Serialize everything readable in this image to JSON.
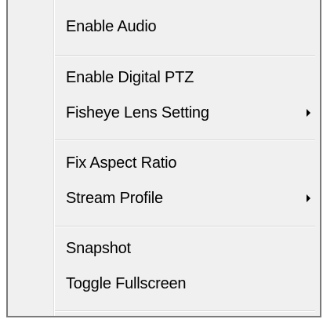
{
  "menu": {
    "items": [
      {
        "label": "Enable Audio"
      },
      {
        "label": "Enable Digital PTZ"
      },
      {
        "label": "Fisheye Lens Setting",
        "submenu": true,
        "arrow_icon": "submenu-arrow-icon"
      },
      {
        "label": "Fix Aspect Ratio"
      },
      {
        "label": "Stream Profile",
        "submenu": true,
        "arrow_icon": "submenu-arrow-icon"
      },
      {
        "label": "Snapshot"
      },
      {
        "label": "Toggle Fullscreen"
      }
    ]
  }
}
